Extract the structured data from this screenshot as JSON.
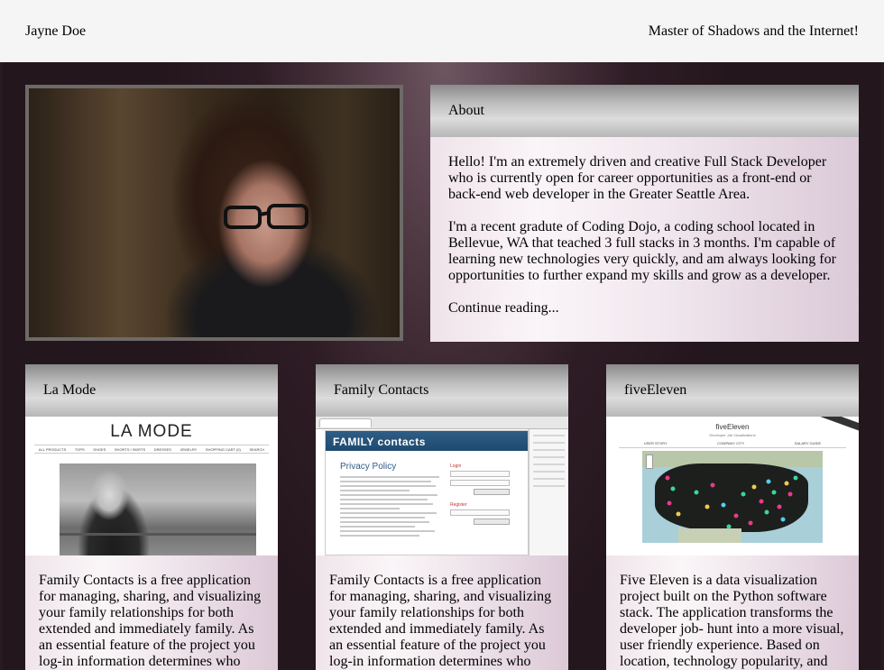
{
  "topbar": {
    "name": "Jayne Doe",
    "tagline": "Master of Shadows and the Internet!"
  },
  "about": {
    "title": "About",
    "paragraphs": [
      "Hello! I'm an extremely driven and creative Full Stack Developer who is currently open for career opportunities as a front-end or back-end web developer in the Greater Seattle Area.",
      "I'm a recent gradute of Coding Dojo, a coding school located in Bellevue, WA that teached 3 full stacks in 3 months. I'm capable of learning new technologies very quickly, and am always looking for opportunities to further expand my skills and grow as a developer."
    ],
    "continue_link": "Continue reading..."
  },
  "projects": [
    {
      "title": "La Mode",
      "description": "Family Contacts is a free application for managing, sharing, and visualizing your family relationships for both extended and immediately family. As an essential feature of the project you log-in information determines who",
      "screenshot": {
        "logo": "LA MODE",
        "nav": [
          "ALL PRODUCTS",
          "TOPS",
          "SHOES",
          "SHORTS / SKIRTS",
          "DRESSES",
          "JEWELRY",
          "SHOPPING CART (0)",
          "SEARCH"
        ]
      }
    },
    {
      "title": "Family Contacts",
      "description": "Family Contacts is a free application for managing, sharing, and visualizing your family relationships for both extended and immediately family. As an essential feature of the project you log-in information determines who",
      "screenshot": {
        "banner": "FAMILY contacts",
        "heading": "Privacy Policy",
        "login_label": "Login",
        "register_label": "Register"
      }
    },
    {
      "title": "fiveEleven",
      "description": "Five Eleven is a data visualization project built on the Python software stack. The application transforms the developer job- hunt into a more visual, user friendly experience. Based on location, technology popularity, and",
      "screenshot": {
        "heading": "fiveEleven",
        "subheading": "Developer Job Visualizations",
        "tabs": [
          "USER STORY",
          "COMPANY CITY",
          "SALARY GUIDE"
        ]
      }
    }
  ],
  "colors": {
    "topbar_bg": "#f5f5f5",
    "stage_bg": "#3a2630",
    "card_header": "#bdbdbd",
    "card_body": "#f1e7ee"
  }
}
